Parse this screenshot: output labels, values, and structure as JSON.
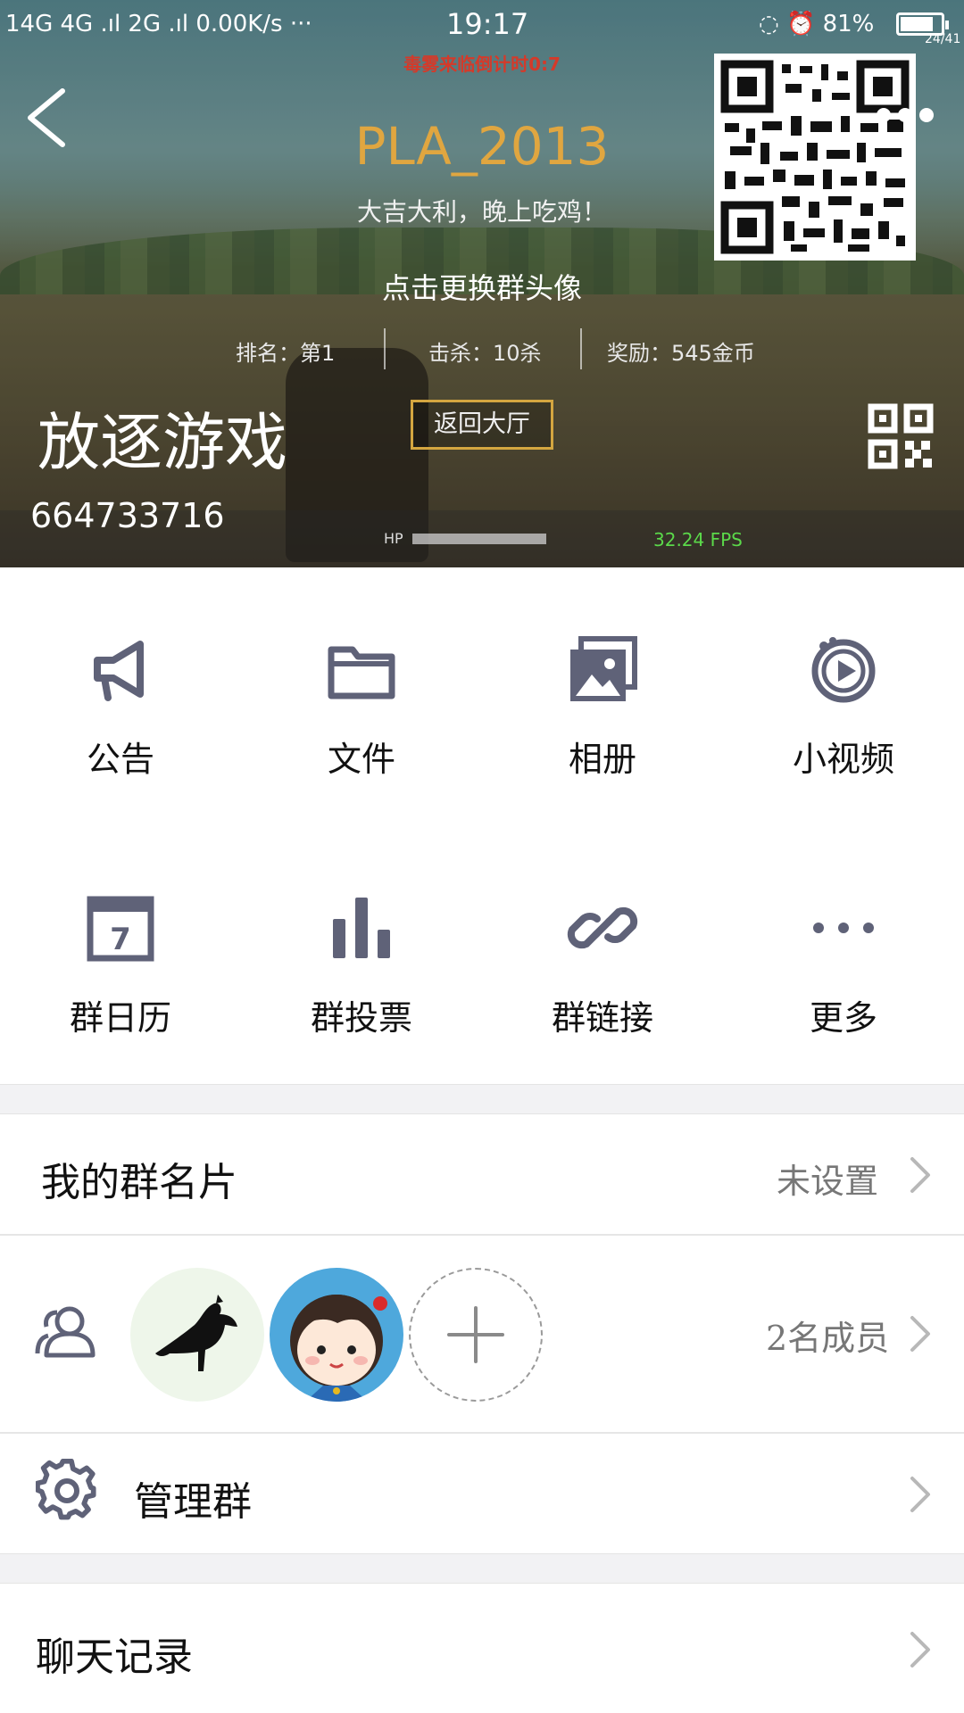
{
  "status_bar": {
    "left": "14G 4G .ıl 2G .ıl 0.00K/s ···",
    "time": "19:17",
    "battery": "81%",
    "battery_level": 0.81,
    "badge": "24/41"
  },
  "header": {
    "game_warning": "毒雾来临倒计时0:7",
    "game_title": "PLA_2013",
    "game_subtitle": "大吉大利，晚上吃鸡！",
    "change_avatar": "点击更换群头像",
    "stats": {
      "rank": "排名：第1",
      "kills": "击杀：10杀",
      "reward": "奖励：545金币"
    },
    "return_button": "返回大厅",
    "hp_label": "HP",
    "fps": "32.24 FPS",
    "group_name": "放逐游戏",
    "group_id": "664733716"
  },
  "features": [
    {
      "label": "公告",
      "icon": "megaphone-icon"
    },
    {
      "label": "文件",
      "icon": "folder-icon"
    },
    {
      "label": "相册",
      "icon": "album-icon"
    },
    {
      "label": "小视频",
      "icon": "video-icon"
    },
    {
      "label": "群日历",
      "icon": "calendar-icon"
    },
    {
      "label": "群投票",
      "icon": "vote-icon"
    },
    {
      "label": "群链接",
      "icon": "link-icon"
    },
    {
      "label": "更多",
      "icon": "more-icon"
    }
  ],
  "calendar_day": "7",
  "my_card": {
    "title": "我的群名片",
    "value": "未设置"
  },
  "members": {
    "count_label": "2名成员"
  },
  "manage": {
    "title": "管理群"
  },
  "chat_history": {
    "title": "聊天记录"
  },
  "colors": {
    "icon": "#5f6278",
    "label": "#111111",
    "muted": "#777777",
    "accent": "#e0a640"
  }
}
